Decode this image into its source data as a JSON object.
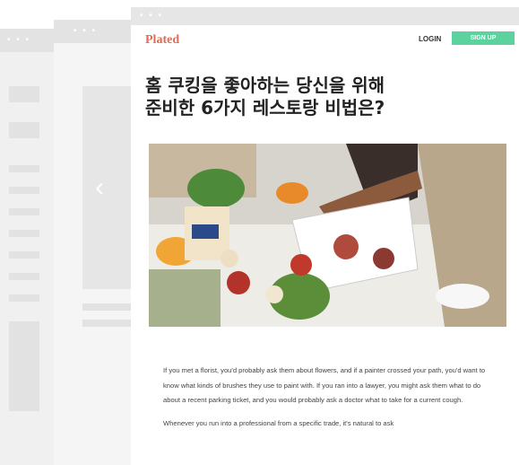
{
  "windows": {
    "back_dots": "• • •",
    "middle_dots": "• • •",
    "middle_chevron": "‹",
    "front_dots": "• • •"
  },
  "header": {
    "logo": "Plated",
    "login_label": "LOGIN",
    "signup_label": "SIGN UP"
  },
  "article": {
    "title_line1": "홈 쿠킹을 좋아하는 당신을 위해",
    "title_line2": "준비한 6가지 레스토랑 비법은?",
    "paragraph1": "If you met a florist, you'd probably ask them about flowers, and if a painter crossed your path, you'd want to know what kinds of brushes they use to paint with. If you ran into a lawyer, you might ask them what to do about a recent parking ticket, and you would probably ask a doctor what to take for a current cough.",
    "paragraph2": "Whenever you run into a professional from a specific trade, it's natural to ask"
  },
  "colors": {
    "brand": "#e36a54",
    "signup": "#5cd29f"
  }
}
